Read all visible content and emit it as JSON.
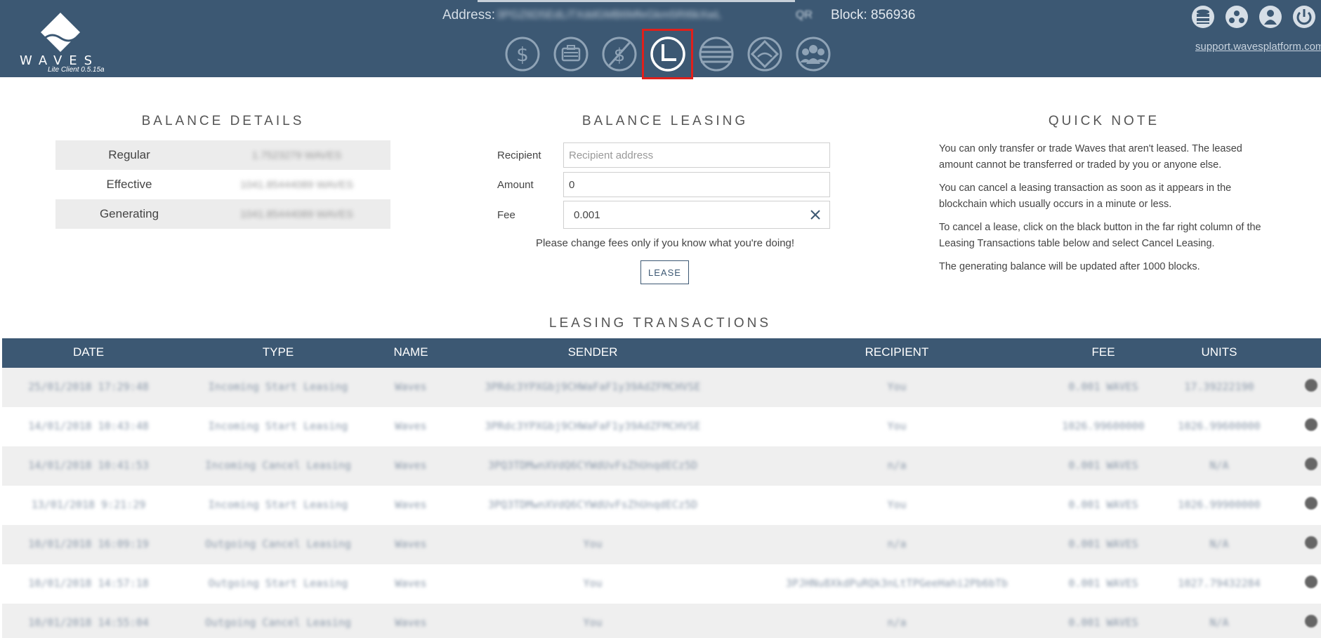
{
  "header": {
    "logo_text": "WAVES",
    "client_version": "Lite Client 0.5.15a",
    "address_label": "Address:",
    "address_value": "3PGZ6D5EdLiTXddGMB6MfeGkm5RI6kXwL",
    "qr_label": "QR",
    "block_label": "Block: 856936",
    "support_link": "support.wavesplatform.com",
    "nav": [
      {
        "name": "wallet",
        "icon": "wallet-icon"
      },
      {
        "name": "portfolio",
        "icon": "portfolio-icon"
      },
      {
        "name": "exchange",
        "icon": "exchange-icon"
      },
      {
        "name": "leasing",
        "icon": "leasing-icon",
        "active": true
      },
      {
        "name": "history",
        "icon": "history-icon"
      },
      {
        "name": "dex",
        "icon": "dex-icon"
      },
      {
        "name": "community",
        "icon": "community-icon"
      }
    ],
    "accent": "#3c5873",
    "highlight": "#e0201b"
  },
  "balance_details": {
    "title": "BALANCE DETAILS",
    "rows": [
      {
        "label": "Regular",
        "value": "1.7523279 WAVES"
      },
      {
        "label": "Effective",
        "value": "1041.85444089 WAVES"
      },
      {
        "label": "Generating",
        "value": "1041.85444089 WAVES"
      }
    ]
  },
  "balance_leasing": {
    "title": "BALANCE LEASING",
    "recipient_label": "Recipient",
    "recipient_placeholder": "Recipient address",
    "amount_label": "Amount",
    "amount_value": "0",
    "fee_label": "Fee",
    "fee_value": "0.001",
    "warning": "Please change fees only if you know what you're doing!",
    "lease_button": "LEASE"
  },
  "quick_note": {
    "title": "QUICK NOTE",
    "paragraphs": [
      "You can only transfer or trade Waves that aren't leased. The leased amount cannot be transferred or traded by you or anyone else.",
      "You can cancel a leasing transaction as soon as it appears in the blockchain which usually occurs in a minute or less.",
      "To cancel a lease, click on the black button in the far right column of the Leasing Transactions table below and select Cancel Leasing.",
      "The generating balance will be updated after 1000 blocks."
    ]
  },
  "leasing_transactions": {
    "title": "LEASING TRANSACTIONS",
    "columns": [
      "DATE",
      "TYPE",
      "NAME",
      "SENDER",
      "RECIPIENT",
      "FEE",
      "UNITS"
    ],
    "rows": [
      [
        "25/01/2018 17:29:48",
        "Incoming Start Leasing",
        "Waves",
        "3PRdc3YPXGbj9CHWaFaF1y39AdZFMCHVSE",
        "You",
        "0.001 WAVES",
        "17.39222190"
      ],
      [
        "14/01/2018 10:43:48",
        "Incoming Start Leasing",
        "Waves",
        "3PRdc3YPXGbj9CHWaFaF1y39AdZFMCHVSE",
        "You",
        "1026.99600000",
        "1026.99600000"
      ],
      [
        "14/01/2018 10:41:53",
        "Incoming Cancel Leasing",
        "Waves",
        "3PQ3TDMwnXVdQ6CYWdUvFsZhUnqdECz5D",
        "n/a",
        "0.001 WAVES",
        "N/A"
      ],
      [
        "13/01/2018 9:21:29",
        "Incoming Start Leasing",
        "Waves",
        "3PQ3TDMwnXVdQ6CYWdUvFsZhUnqdECz5D",
        "You",
        "0.001 WAVES",
        "1026.99900000"
      ],
      [
        "10/01/2018 16:09:19",
        "Outgoing Cancel Leasing",
        "Waves",
        "You",
        "n/a",
        "0.001 WAVES",
        "N/A"
      ],
      [
        "10/01/2018 14:57:18",
        "Outgoing Start Leasing",
        "Waves",
        "You",
        "3PJHNu8XkdPuRQk3nLtTPGeeHahi2Pb6bTb",
        "0.001 WAVES",
        "1027.79432284"
      ],
      [
        "10/01/2018 14:55:04",
        "Outgoing Cancel Leasing",
        "Waves",
        "You",
        "n/a",
        "0.001 WAVES",
        "N/A"
      ]
    ]
  }
}
